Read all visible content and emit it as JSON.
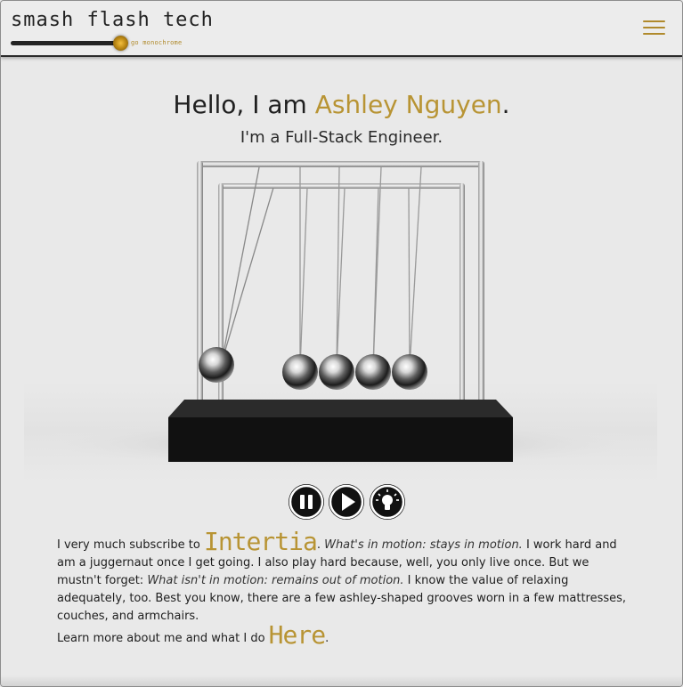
{
  "header": {
    "logo": "smash flash tech",
    "mono_label": "go monochrome"
  },
  "hero": {
    "greeting": "Hello, I am ",
    "name": "Ashley Nguyen",
    "period": ".",
    "subtitle": "I'm a Full-Stack Engineer."
  },
  "controls": [
    "pause-icon",
    "play-icon",
    "lightbulb-icon"
  ],
  "about": {
    "p1_a": "I very much subscribe to ",
    "p1_word": "Intertia",
    "p1_b": ". ",
    "p1_quote1": "What's in motion: stays in motion.",
    "p1_c": " I work hard and am a juggernaut once I get going. I also play hard because, well, you only live once. But we mustn't forget: ",
    "p1_quote2": "What isn't in motion: remains out of motion.",
    "p1_d": " I know the value of relaxing adequately, too. Best you know, there are a few ashley-shaped grooves worn in a few mattresses, couches, and armchairs.",
    "p2_a": "Learn more about me and what I do ",
    "p2_link": "Here",
    "p2_b": "."
  },
  "colors": {
    "accent": "#b89434",
    "text": "#1e1e1e",
    "background": "#e9e9e9"
  }
}
